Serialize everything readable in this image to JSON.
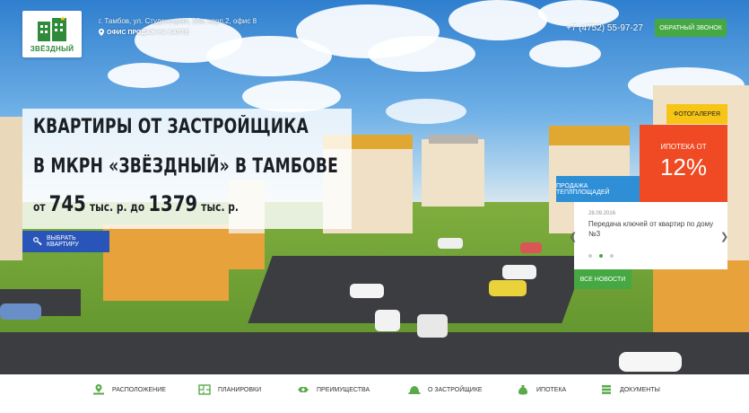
{
  "header": {
    "logo_text": "ЗВЁЗДНЫЙ",
    "address": "г. Тамбов, ул. Студенецкая, 16а, корп.2, офис 8",
    "office_link": "ОФИС ПРОДАЖ НА КАРТЕ",
    "phone": "+7 (4752) 55-97-27",
    "callback_label": "ОБРАТНЫЙ ЗВОНОК"
  },
  "hero": {
    "title_line1": "КВАРТИРЫ ОТ ЗАСТРОЙЩИКА",
    "title_line2": "В МКРН «ЗВЁЗДНЫЙ» В ТАМБОВЕ",
    "price_from": "от",
    "price_min": "745",
    "price_unit1": "тыс. р. до",
    "price_max": "1379",
    "price_unit2": "тыс. р.",
    "choose_label": "ВЫБРАТЬ КВАРТИРУ"
  },
  "panel": {
    "photo_label": "ФОТОГАЛЕРЕЯ",
    "mortgage_label": "ИПОТЕКА ОТ",
    "mortgage_rate": "12%",
    "greenhouse_label": "ПРОДАЖА ТЕПЛПЛОЩАДЕЙ",
    "news_date": "28.09.2016",
    "news_title": "Передача ключей от квартир по дому №3",
    "all_news_label": "ВСЕ НОВОСТИ",
    "slides_total": 3,
    "slide_active": 2
  },
  "bottom_nav": [
    {
      "label": "РАСПОЛОЖЕНИЕ",
      "icon": "location-icon"
    },
    {
      "label": "ПЛАНИРОВКИ",
      "icon": "floorplan-icon"
    },
    {
      "label": "ПРЕИМУЩЕСТВА",
      "icon": "advantages-icon"
    },
    {
      "label": "О ЗАСТРОЙЩИКЕ",
      "icon": "helmet-icon"
    },
    {
      "label": "ИПОТЕКА",
      "icon": "moneybag-icon"
    },
    {
      "label": "ДОКУМЕНТЫ",
      "icon": "documents-icon"
    }
  ],
  "colors": {
    "green": "#46a842",
    "blue": "#2a55b8",
    "orange": "#ef4a23",
    "yellow": "#f6c515",
    "light_blue": "#2f8fd6"
  }
}
